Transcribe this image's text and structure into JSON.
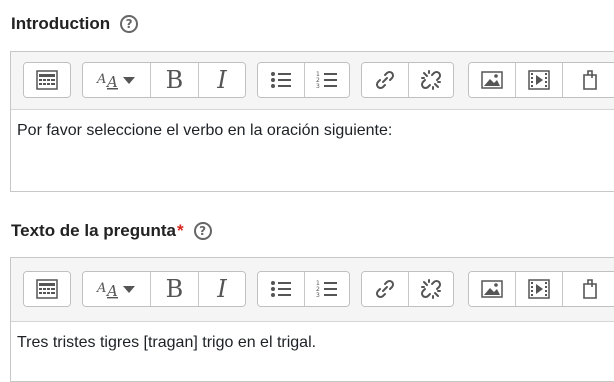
{
  "section1": {
    "label": "Introduction",
    "help_icon": "?",
    "content": "Por favor seleccione el verbo en la oración siguiente:"
  },
  "section2": {
    "label": "Texto de la pregunta",
    "required_marker": "*",
    "help_icon": "?",
    "content": "Tres tristes tigres [tragan] trigo en el trigal."
  },
  "toolbar": {
    "bold_label": "B",
    "italic_label": "I",
    "buttons": [
      "toolbar-toggle-icon",
      "font-size-icon",
      "bold-icon",
      "italic-icon",
      "unordered-list-icon",
      "ordered-list-icon",
      "link-icon",
      "unlink-icon",
      "image-icon",
      "media-icon",
      "manage-files-icon"
    ]
  },
  "colors": {
    "border": "#c7c7c7",
    "toolbar_bg": "#f5f5f5",
    "required": "#d9261c",
    "icon": "#444444"
  }
}
